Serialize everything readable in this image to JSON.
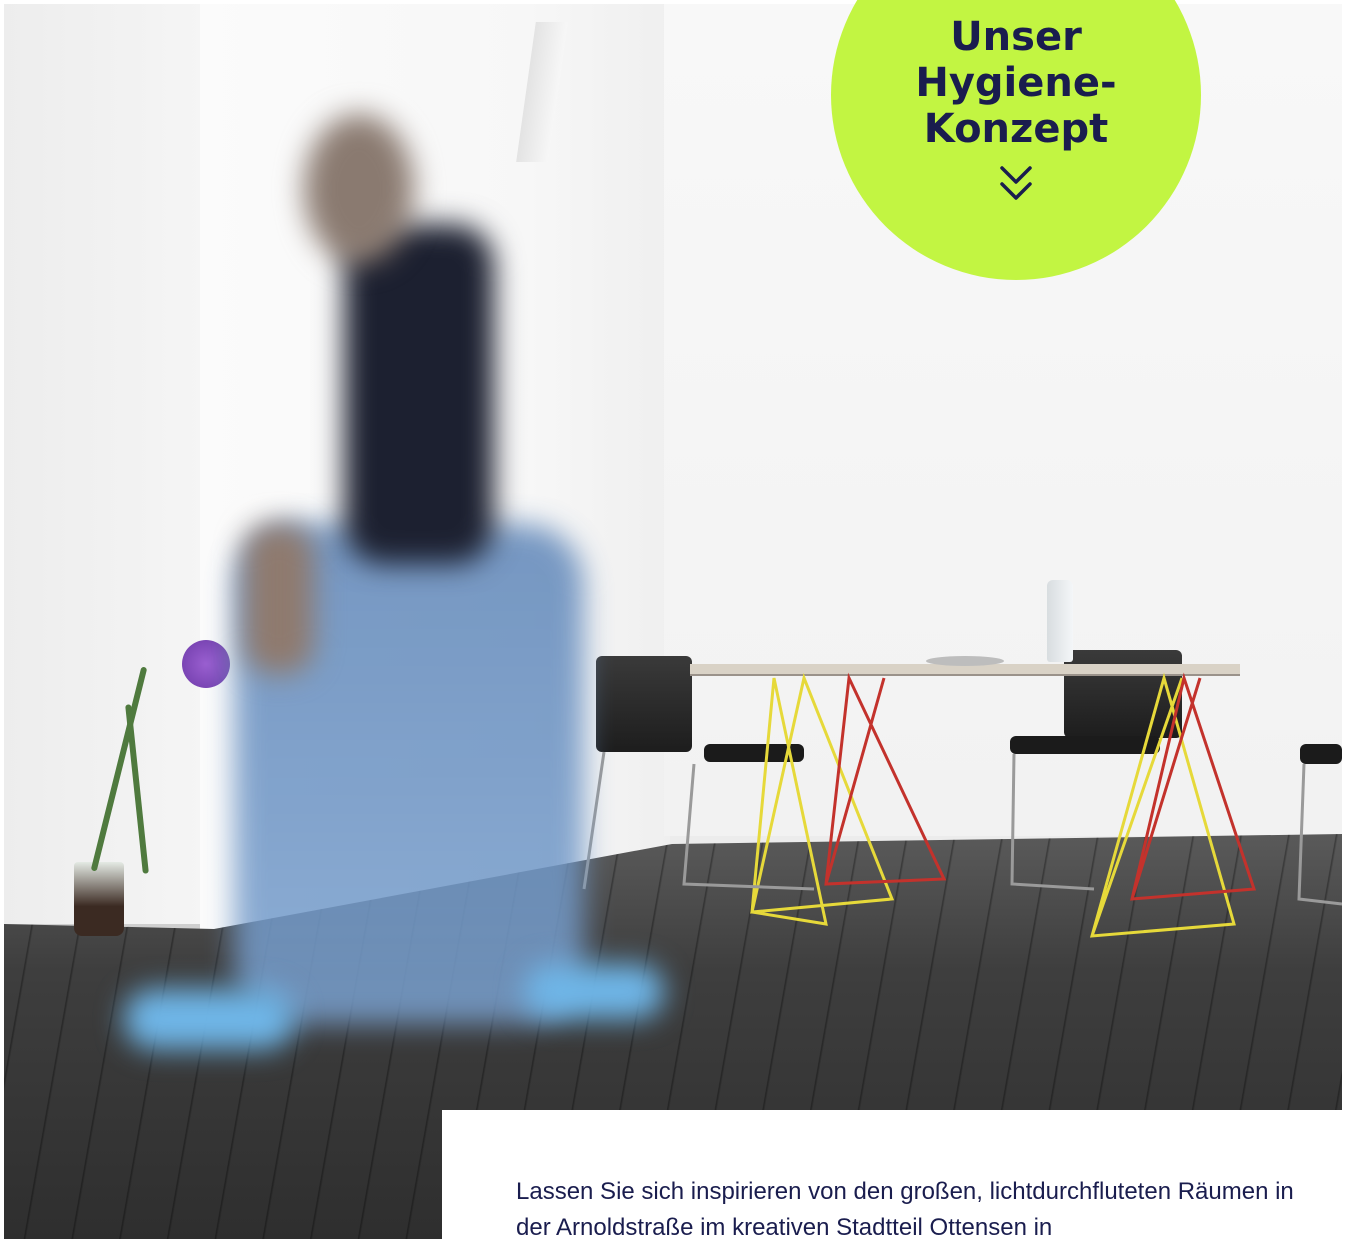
{
  "badge": {
    "lines": [
      "Unser",
      "Hygiene-",
      "Konzept"
    ],
    "background": "#c2f542",
    "text_color": "#1a1d4e",
    "icon": "double-chevron-down-icon"
  },
  "hero_image": {
    "alt": ""
  },
  "intro": {
    "text": "Lassen Sie sich inspirieren von den großen, lichtdurchfluteten Räumen in der Arnoldstraße im kreativen Stadtteil Ottensen in"
  }
}
